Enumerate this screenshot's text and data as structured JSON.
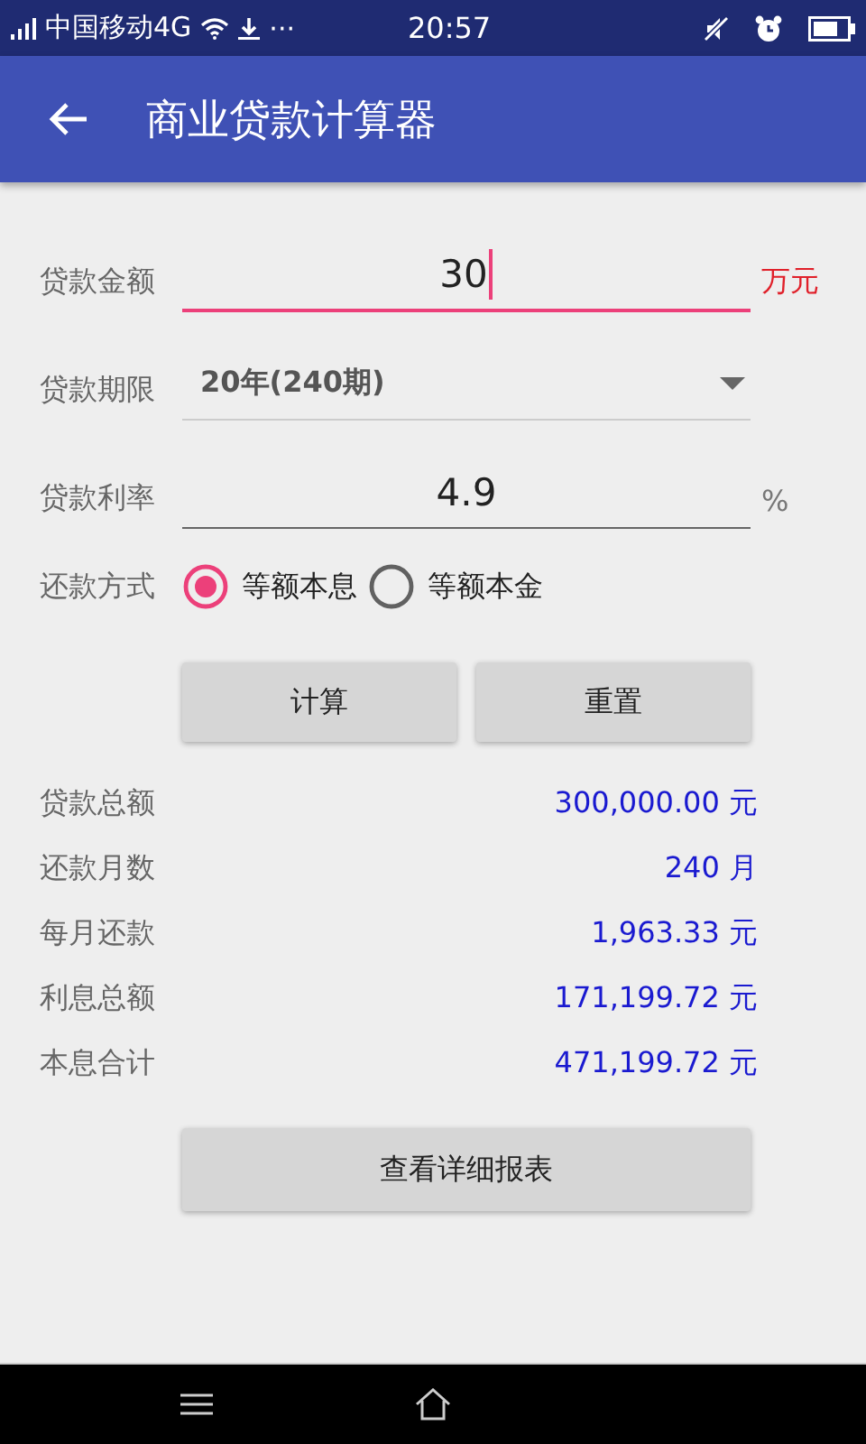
{
  "status_bar": {
    "carrier": "中国移动4G",
    "more": "···",
    "time": "20:57"
  },
  "app_bar": {
    "title": "商业贷款计算器"
  },
  "fields": [
    {
      "kind": "input",
      "label": "贷款金额",
      "value": "30",
      "unit": "万元",
      "focused": true
    },
    {
      "kind": "dropdown",
      "label": "贷款期限",
      "value": "20年(240期)"
    },
    {
      "kind": "input",
      "label": "贷款利率",
      "value": "4.9",
      "unit": "%",
      "focused": false
    }
  ],
  "repayment": {
    "label": "还款方式",
    "options": [
      {
        "label": "等额本息",
        "selected": true
      },
      {
        "label": "等额本金",
        "selected": false
      }
    ]
  },
  "buttons": [
    "计算",
    "重置"
  ],
  "results": [
    {
      "label": "贷款总额",
      "value": "300,000.00 元"
    },
    {
      "label": "还款月数",
      "value": "240 月"
    },
    {
      "label": "每月还款",
      "value": "1,963.33 元"
    },
    {
      "label": "利息总额",
      "value": "171,199.72 元"
    },
    {
      "label": "本息合计",
      "value": "471,199.72 元"
    }
  ],
  "detail_button": "查看详细报表"
}
